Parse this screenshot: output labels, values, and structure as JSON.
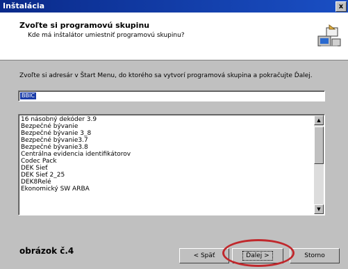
{
  "window": {
    "title": "Inštalácia",
    "close_label": "x"
  },
  "header": {
    "title": "Zvoľte si programovú skupinu",
    "subtitle": "Kde má inštalátor umiestniť programovú skupinu?",
    "icon": "installer-computer-icon"
  },
  "description": "Zvoľte si adresár v Štart Menu, do ktorého sa vytvorí programová skupina a pokračujte Ďalej.",
  "group_input": {
    "value": "BBIC"
  },
  "program_list": {
    "items": [
      "16 násobný dekóder 3.9",
      "Bezpečné bývanie",
      "Bezpečné bývanie 3_8",
      "Bezpečné bývanie3.7",
      "Bezpečné bývanie3.8",
      "Centrálna evidencia identifikátorov",
      "Codec Pack",
      "DEK Sieť",
      "DEK Sieť 2_25",
      "DEK8Relé",
      "Ekonomický SW ARBA"
    ]
  },
  "caption": "obrázok č.4",
  "buttons": {
    "back": "< Späť",
    "next": "Ďalej >",
    "cancel": "Storno"
  },
  "colors": {
    "highlight_ring": "#c0282c",
    "selection": "#1a3ca8",
    "titlebar": "#0a2a8a"
  }
}
